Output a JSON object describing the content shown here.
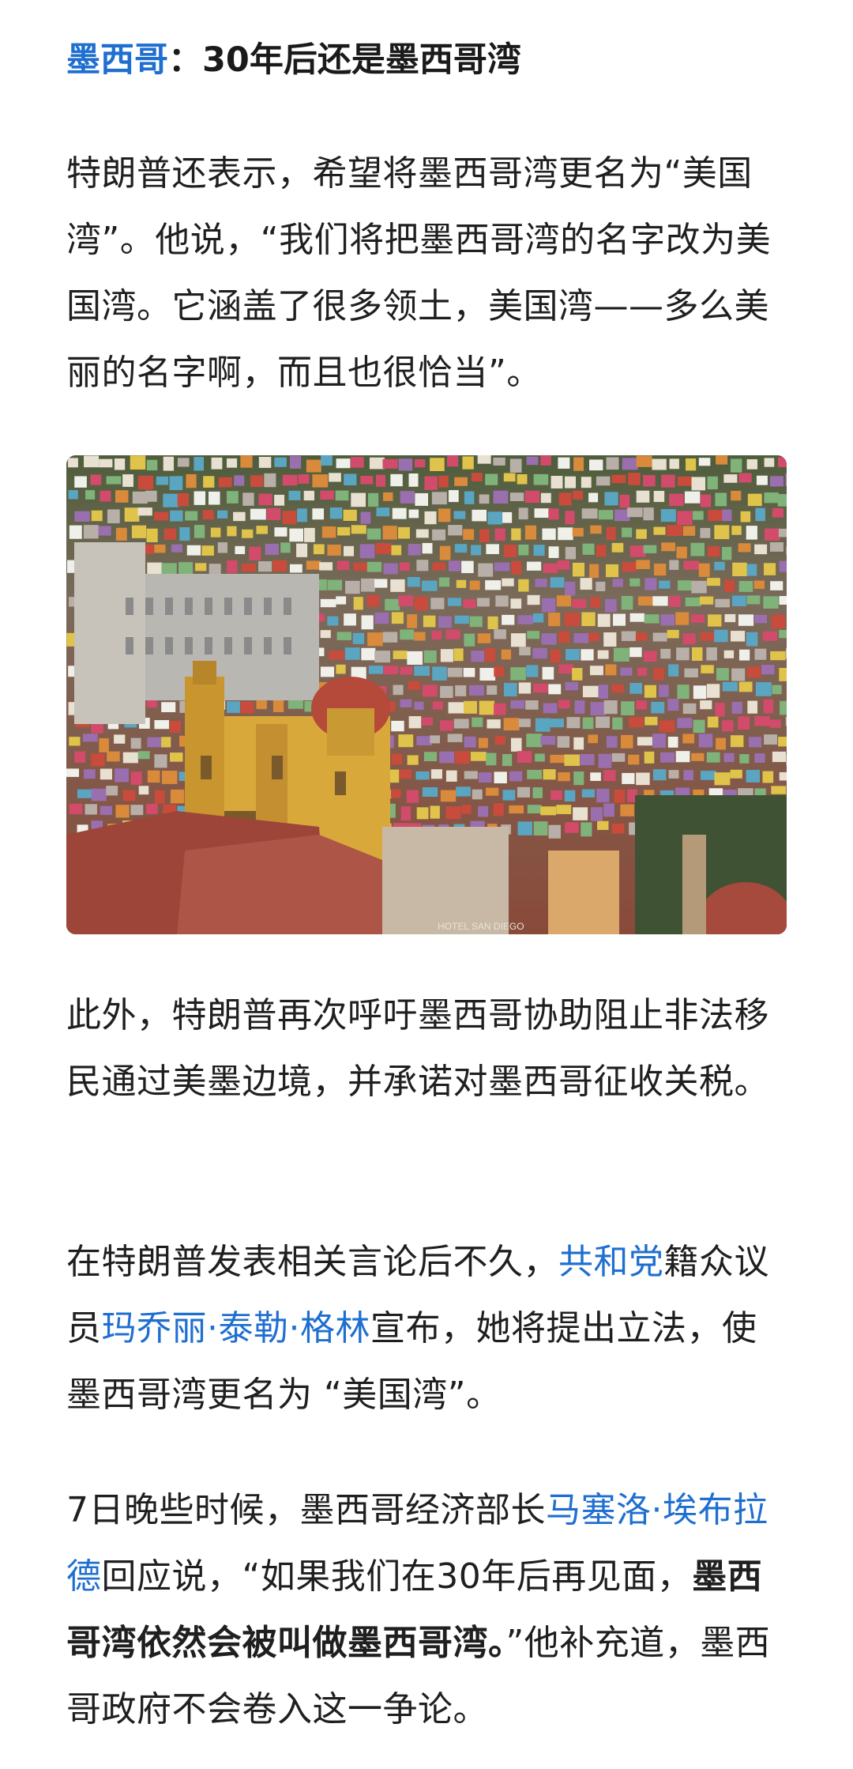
{
  "heading": {
    "country_link": "墨西哥",
    "rest": "：30年后还是墨西哥湾"
  },
  "paragraph1": "特朗普还表示，希望将墨西哥湾更名为“美国湾”。他说，“我们将把墨西哥湾的名字改为美国湾。它涵盖了很多领土，美国湾——多么美丽的名字啊，而且也很恰当”。",
  "image": {
    "sign_text": "HOTEL SAN DIEGO"
  },
  "paragraph2": "此外，特朗普再次呼吁墨西哥协助阻止非法移民通过美墨边境，并承诺对墨西哥征收关税。",
  "paragraph3": {
    "part1": "在特朗普发表相关言论后不久，",
    "link1": "共和党",
    "part2": "籍众议员",
    "link2": "玛乔丽·泰勒·格林",
    "part3": "宣布，她将提出立法，使墨西哥湾更名为 “美国湾”。"
  },
  "paragraph4": {
    "part1": "7日晚些时候，墨西哥经济部长",
    "link1": "马塞洛·埃布拉德",
    "part2": "回应说，“如果我们在30年后再见面，",
    "bold": "墨西哥湾依然会被叫做墨西哥湾。",
    "part3": "”他补充道，墨西哥政府不会卷入这一争论。"
  },
  "colors": {
    "link": "#1f6fd0",
    "text": "#1f1f1f"
  }
}
